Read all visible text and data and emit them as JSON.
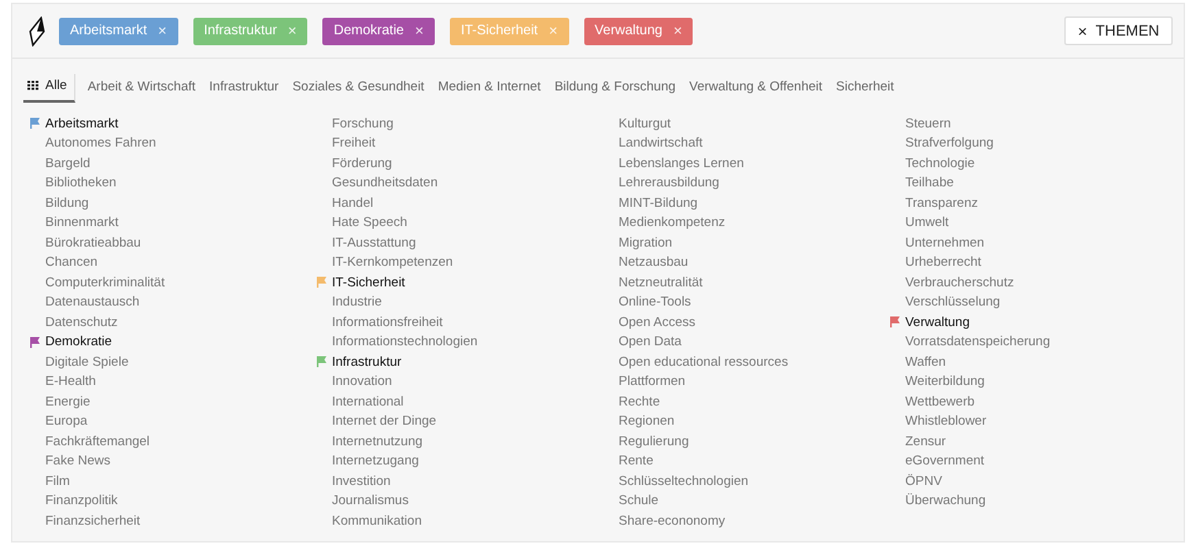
{
  "selected_topics": [
    {
      "label": "Arbeitsmarkt",
      "color": "#6a9fd4",
      "remove": "×"
    },
    {
      "label": "Infrastruktur",
      "color": "#7cc47a",
      "remove": "×"
    },
    {
      "label": "Demokratie",
      "color": "#a64fa6",
      "remove": "×"
    },
    {
      "label": "IT-Sicherheit",
      "color": "#f4bb6c",
      "remove": "×"
    },
    {
      "label": "Verwaltung",
      "color": "#e06b6b",
      "remove": "×"
    }
  ],
  "themes_button": {
    "icon": "×",
    "label": "THEMEN"
  },
  "tabs": [
    {
      "label": "Alle",
      "selected": true
    },
    {
      "label": "Arbeit & Wirtschaft",
      "selected": false
    },
    {
      "label": "Infrastruktur",
      "selected": false
    },
    {
      "label": "Soziales & Gesundheit",
      "selected": false
    },
    {
      "label": "Medien & Internet",
      "selected": false
    },
    {
      "label": "Bildung & Forschung",
      "selected": false
    },
    {
      "label": "Verwaltung & Offenheit",
      "selected": false
    },
    {
      "label": "Sicherheit",
      "selected": false
    }
  ],
  "topic_columns": [
    [
      {
        "label": "Arbeitsmarkt",
        "selected": true,
        "color": "#6a9fd4"
      },
      {
        "label": "Autonomes Fahren",
        "selected": false
      },
      {
        "label": "Bargeld",
        "selected": false
      },
      {
        "label": "Bibliotheken",
        "selected": false
      },
      {
        "label": "Bildung",
        "selected": false
      },
      {
        "label": "Binnenmarkt",
        "selected": false
      },
      {
        "label": "Bürokratieabbau",
        "selected": false
      },
      {
        "label": "Chancen",
        "selected": false
      },
      {
        "label": "Computerkriminalität",
        "selected": false
      },
      {
        "label": "Datenaustausch",
        "selected": false
      },
      {
        "label": "Datenschutz",
        "selected": false
      },
      {
        "label": "Demokratie",
        "selected": true,
        "color": "#a64fa6"
      },
      {
        "label": "Digitale Spiele",
        "selected": false
      },
      {
        "label": "E-Health",
        "selected": false
      },
      {
        "label": "Energie",
        "selected": false
      },
      {
        "label": "Europa",
        "selected": false
      },
      {
        "label": "Fachkräftemangel",
        "selected": false
      },
      {
        "label": "Fake News",
        "selected": false
      },
      {
        "label": "Film",
        "selected": false
      },
      {
        "label": "Finanzpolitik",
        "selected": false
      },
      {
        "label": "Finanzsicherheit",
        "selected": false
      }
    ],
    [
      {
        "label": "Forschung",
        "selected": false
      },
      {
        "label": "Freiheit",
        "selected": false
      },
      {
        "label": "Förderung",
        "selected": false
      },
      {
        "label": "Gesundheitsdaten",
        "selected": false
      },
      {
        "label": "Handel",
        "selected": false
      },
      {
        "label": "Hate Speech",
        "selected": false
      },
      {
        "label": "IT-Ausstattung",
        "selected": false
      },
      {
        "label": "IT-Kernkompetenzen",
        "selected": false
      },
      {
        "label": "IT-Sicherheit",
        "selected": true,
        "color": "#f4bb6c"
      },
      {
        "label": "Industrie",
        "selected": false
      },
      {
        "label": "Informationsfreiheit",
        "selected": false
      },
      {
        "label": "Informationstechnologien",
        "selected": false
      },
      {
        "label": "Infrastruktur",
        "selected": true,
        "color": "#7cc47a"
      },
      {
        "label": "Innovation",
        "selected": false
      },
      {
        "label": "International",
        "selected": false
      },
      {
        "label": "Internet der Dinge",
        "selected": false
      },
      {
        "label": "Internetnutzung",
        "selected": false
      },
      {
        "label": "Internetzugang",
        "selected": false
      },
      {
        "label": "Investition",
        "selected": false
      },
      {
        "label": "Journalismus",
        "selected": false
      },
      {
        "label": "Kommunikation",
        "selected": false
      }
    ],
    [
      {
        "label": "Kulturgut",
        "selected": false
      },
      {
        "label": "Landwirtschaft",
        "selected": false
      },
      {
        "label": "Lebenslanges Lernen",
        "selected": false
      },
      {
        "label": "Lehrerausbildung",
        "selected": false
      },
      {
        "label": "MINT-Bildung",
        "selected": false
      },
      {
        "label": "Medienkompetenz",
        "selected": false
      },
      {
        "label": "Migration",
        "selected": false
      },
      {
        "label": "Netzausbau",
        "selected": false
      },
      {
        "label": "Netzneutralität",
        "selected": false
      },
      {
        "label": "Online-Tools",
        "selected": false
      },
      {
        "label": "Open Access",
        "selected": false
      },
      {
        "label": "Open Data",
        "selected": false
      },
      {
        "label": "Open educational ressources",
        "selected": false
      },
      {
        "label": "Plattformen",
        "selected": false
      },
      {
        "label": "Rechte",
        "selected": false
      },
      {
        "label": "Regionen",
        "selected": false
      },
      {
        "label": "Regulierung",
        "selected": false
      },
      {
        "label": "Rente",
        "selected": false
      },
      {
        "label": "Schlüsseltechnologien",
        "selected": false
      },
      {
        "label": "Schule",
        "selected": false
      },
      {
        "label": "Share-econonomy",
        "selected": false
      }
    ],
    [
      {
        "label": "Steuern",
        "selected": false
      },
      {
        "label": "Strafverfolgung",
        "selected": false
      },
      {
        "label": "Technologie",
        "selected": false
      },
      {
        "label": "Teilhabe",
        "selected": false
      },
      {
        "label": "Transparenz",
        "selected": false
      },
      {
        "label": "Umwelt",
        "selected": false
      },
      {
        "label": "Unternehmen",
        "selected": false
      },
      {
        "label": "Urheberrecht",
        "selected": false
      },
      {
        "label": "Verbraucherschutz",
        "selected": false
      },
      {
        "label": "Verschlüsselung",
        "selected": false
      },
      {
        "label": "Verwaltung",
        "selected": true,
        "color": "#e06b6b"
      },
      {
        "label": "Vorratsdatenspeicherung",
        "selected": false
      },
      {
        "label": "Waffen",
        "selected": false
      },
      {
        "label": "Weiterbildung",
        "selected": false
      },
      {
        "label": "Wettbewerb",
        "selected": false
      },
      {
        "label": "Whistleblower",
        "selected": false
      },
      {
        "label": "Zensur",
        "selected": false
      },
      {
        "label": "eGovernment",
        "selected": false
      },
      {
        "label": "ÖPNV",
        "selected": false
      },
      {
        "label": "Überwachung",
        "selected": false
      }
    ]
  ]
}
